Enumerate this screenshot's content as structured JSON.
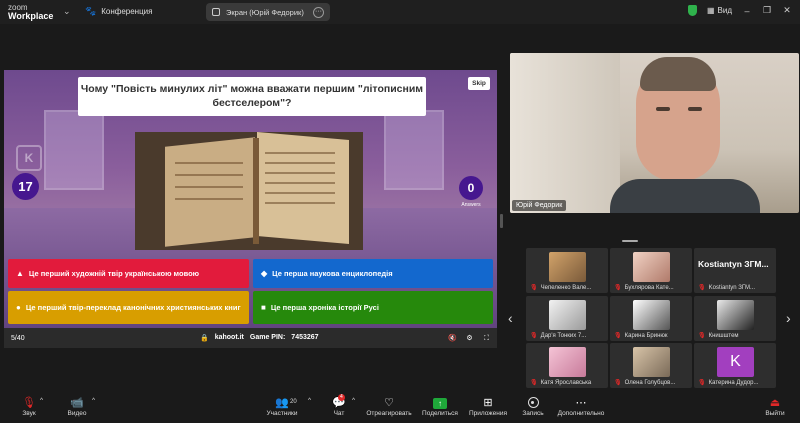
{
  "titlebar": {
    "logo_line1": "zoom",
    "logo_line2": "Workplace",
    "meeting_label": "Конференция",
    "screen_share_label": "Экран (Юрій Федорик)",
    "view_label": "Вид"
  },
  "kahoot": {
    "question": "Чому \"Повість минулих літ\" можна вважати першим \"літописним бестселером\"?",
    "skip": "Skip",
    "timer": "17",
    "answers_count": "0",
    "answers_label": "Answers",
    "answers": [
      {
        "shape": "▲",
        "text": "Це перший художній твір українською мовою",
        "color": "#e21b3c"
      },
      {
        "shape": "◆",
        "text": "Це перша наукова енциклопедія",
        "color": "#1368ce"
      },
      {
        "shape": "●",
        "text": "Це перший твір-переклад канонічних християнських книг",
        "color": "#d89e00"
      },
      {
        "shape": "■",
        "text": "Це перша хроніка історії Русі",
        "color": "#26890c"
      }
    ],
    "page": "5/40",
    "site": "kahoot.it",
    "game_pin_label": "Game PIN:",
    "game_pin": "7453267"
  },
  "speaker": {
    "name": "Юрій Федорик"
  },
  "gallery": {
    "tiles": [
      {
        "name": "Чепеленко Вале...",
        "muted": true,
        "avatar": "photo-cat"
      },
      {
        "name": "Бухлярова Кате...",
        "muted": true,
        "avatar": "photo-girl"
      },
      {
        "name": "Kostiantyn ЗГМ...",
        "muted": true,
        "display": "Kostiantyn  ЗГМ..."
      },
      {
        "name": "Дар'я Тонких 7...",
        "muted": true,
        "avatar": "photo-cat-white"
      },
      {
        "name": "Карина Бринюк",
        "muted": true,
        "avatar": "anime"
      },
      {
        "name": "Книшштем",
        "muted": true,
        "avatar": "anime-dark"
      },
      {
        "name": "Катя Ярославська",
        "muted": true,
        "avatar": "photo-pink"
      },
      {
        "name": "Олена Голубцов...",
        "muted": true,
        "avatar": "photo-family"
      },
      {
        "name": "Катерина Дудор...",
        "muted": true,
        "initial": "K"
      }
    ]
  },
  "toolbar": {
    "audio": "Звук",
    "video": "Видео",
    "participants": "Участники",
    "participants_count": "20",
    "chat": "Чат",
    "chat_badge": "4",
    "react": "Отреагировать",
    "share": "Поделиться",
    "apps": "Приложения",
    "record": "Запись",
    "more": "Дополнительно",
    "leave": "Выйти"
  },
  "colors": {
    "accent_green": "#1fa83a",
    "mute_red": "#e02828",
    "kahoot_purple": "#46178f"
  }
}
